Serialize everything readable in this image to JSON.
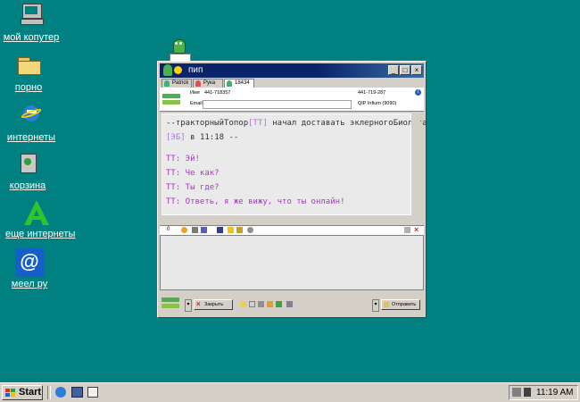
{
  "desktop": {
    "icons": [
      {
        "label": "мой копутер",
        "icon": "computer-icon"
      },
      {
        "label": "порно",
        "icon": "folder-icon"
      },
      {
        "label": "интернеты",
        "icon": "internet-explorer-icon"
      },
      {
        "label": "корзина",
        "icon": "recycle-bin-icon"
      },
      {
        "label": "еще интернеты",
        "icon": "green-a-icon"
      },
      {
        "label": "меел ру",
        "icon": "mail-at-icon"
      }
    ]
  },
  "window": {
    "title": "пип",
    "tabs": [
      "Patrick",
      "Рука",
      "18434"
    ],
    "info": {
      "name_label": "Имя",
      "name_value": "441-718357",
      "email_label": "Email",
      "phone": "441-719-287",
      "client": "QIP Infium (9090)"
    },
    "chat": {
      "system_line1_prefix": "--тракторныйТопор",
      "system_tag1": "[TT]",
      "system_line1_suffix": " начал доставать эклерногоБиолога",
      "system_tag2": "[ЭБ]",
      "system_line2_suffix": " в 11:18 --",
      "messages": [
        "TT: Эй!",
        "TT: Че как?",
        "TT: Ты где?",
        "TT: Ответь, я же вижу, что ты онлайн!"
      ]
    },
    "inputbar": {
      "counter": "0"
    },
    "bottom": {
      "close_label": "Закрыть",
      "send_label": "Отправить"
    }
  },
  "taskbar": {
    "start_label": "Start",
    "clock": "11:19 AM"
  },
  "colors": {
    "desktop": "#008080",
    "title": "#0a246a",
    "system_text": "#333333",
    "tag_text": "#b070e0",
    "message_text": "#b030d0"
  }
}
